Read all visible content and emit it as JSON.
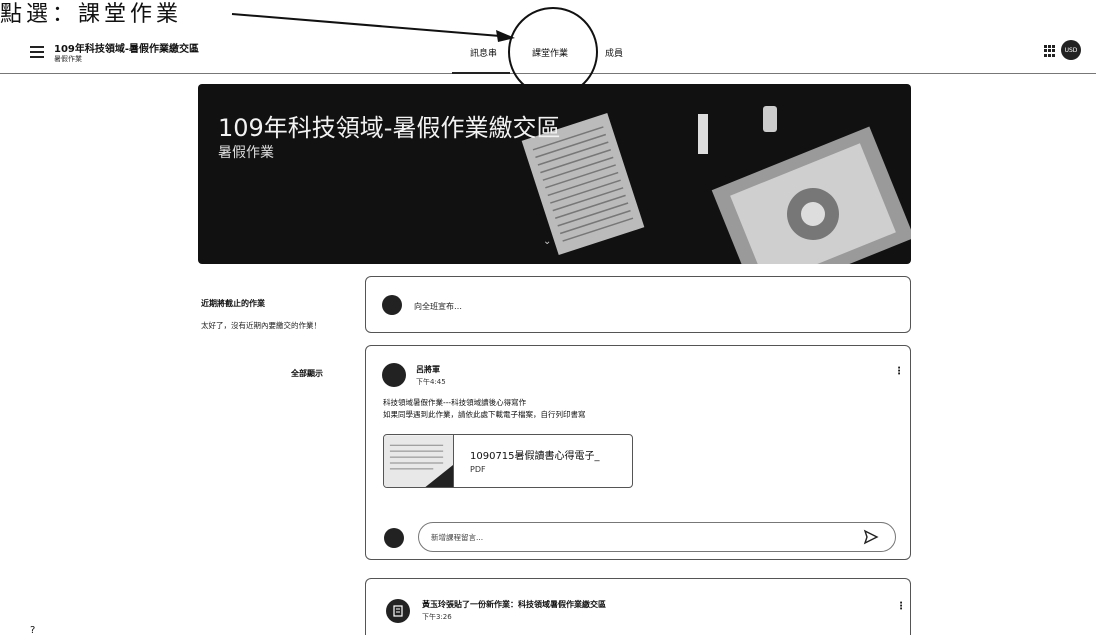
{
  "annotation": {
    "text": "點選：課堂作業"
  },
  "header": {
    "class_title": "109年科技領域-暑假作業繳交區",
    "class_subtitle": "暑假作業",
    "tabs": [
      {
        "label": "訊息串"
      },
      {
        "label": "課堂作業"
      },
      {
        "label": "成員"
      }
    ],
    "avatar_text": "USD"
  },
  "banner": {
    "title": "109年科技領域-暑假作業繳交區",
    "subtitle": "暑假作業"
  },
  "upcoming": {
    "title": "近期將截止的作業",
    "text": "太好了，沒有近期內要繳交的作業！",
    "view_all": "全部顯示"
  },
  "announce": {
    "placeholder": "向全班宣布…"
  },
  "post": {
    "author": "呂將軍",
    "time": "下午4:45",
    "line1": "科技領域暑假作業---科技領域讀後心得寫作",
    "line2": "如果同學遇到此作業，請依此處下載電子檔案，自行列印書寫",
    "attachment": {
      "name": "1090715暑假讀書心得電子_",
      "type": "PDF"
    },
    "comment_placeholder": "新增課程留言..."
  },
  "post2": {
    "text": "黃玉玲張貼了一份新作業：科技領域暑假作業繳交區",
    "time": "下午3:26"
  },
  "colors": {
    "banner_bg": "#111111",
    "border": "#555555"
  }
}
